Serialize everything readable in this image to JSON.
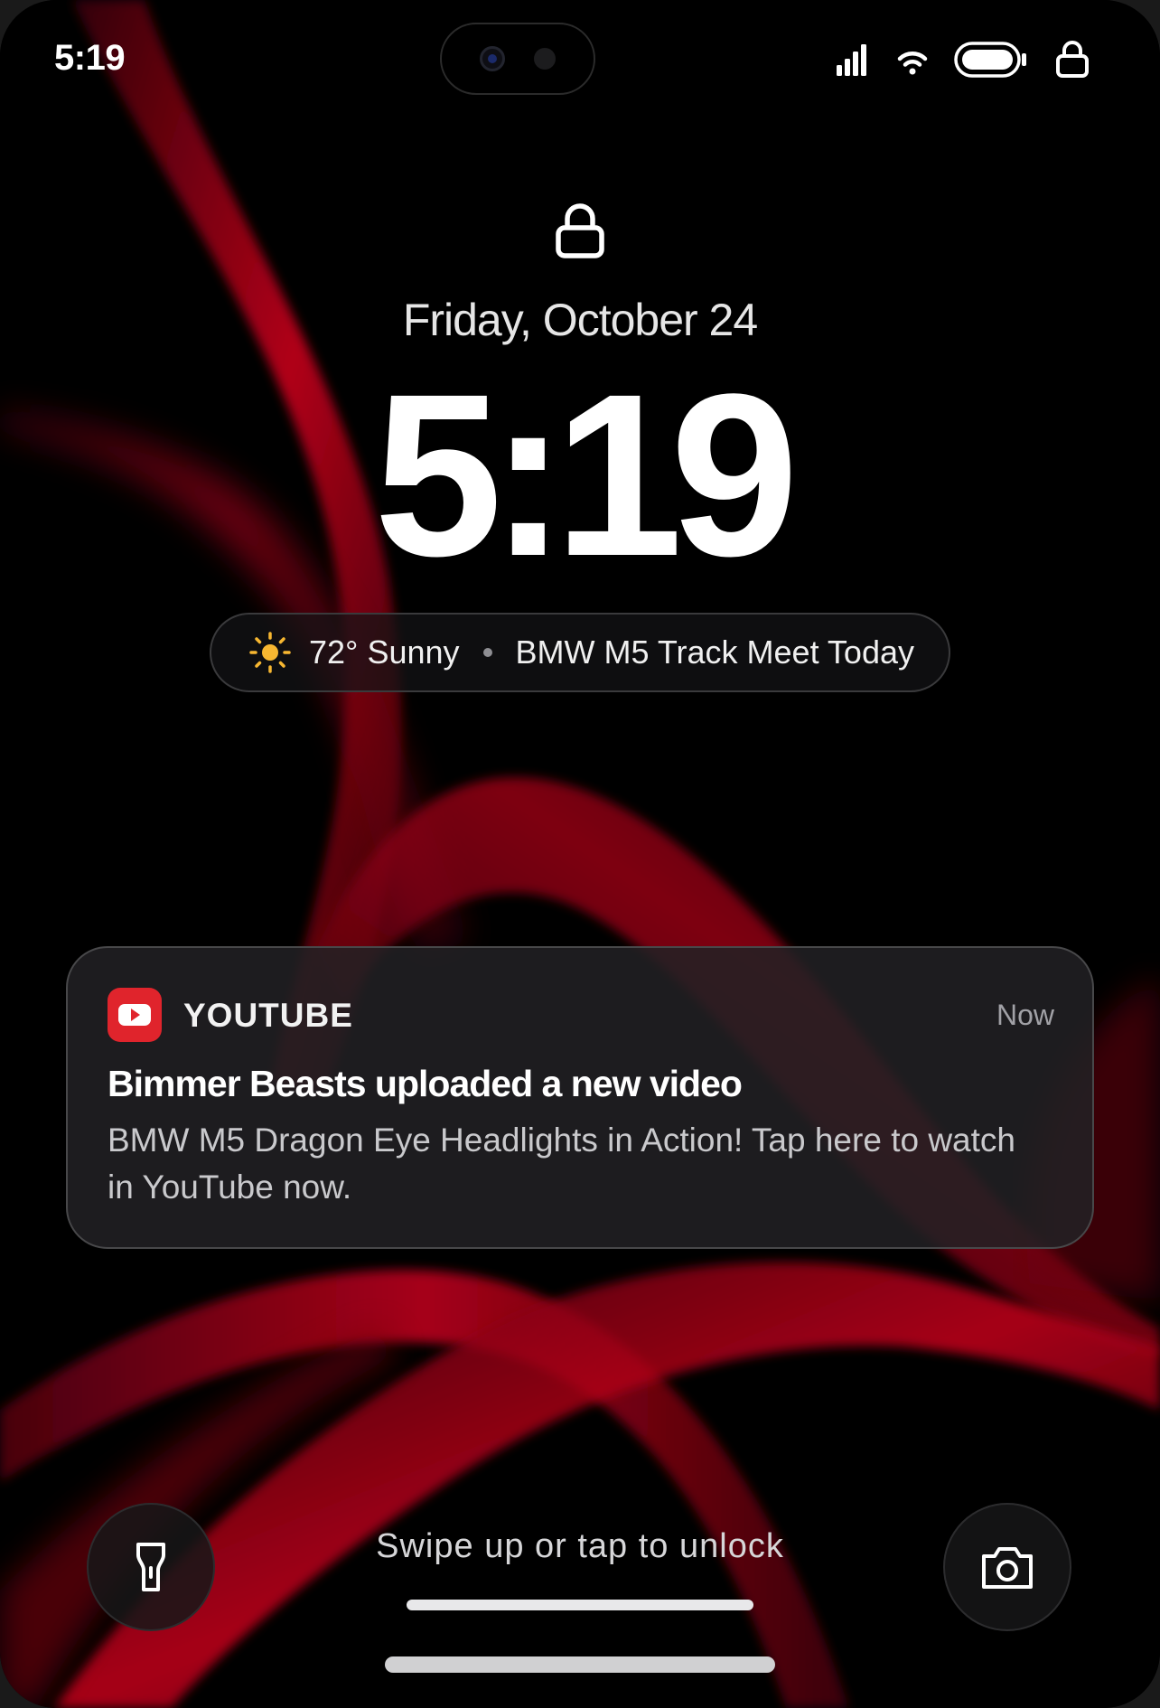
{
  "status_bar": {
    "time": "5:19",
    "icons": [
      "signal-icon",
      "wifi-icon",
      "battery-icon",
      "lock-icon"
    ]
  },
  "lock_screen": {
    "lock_icon": "lock-icon",
    "date": "Friday, October 24",
    "time": "5:19"
  },
  "widget": {
    "weather_icon": "sun-icon",
    "weather": "72° Sunny",
    "event": "BMW M5 Track Meet Today"
  },
  "notification": {
    "app_icon": "youtube-icon",
    "app_name": "YOUTUBE",
    "time": "Now",
    "title": "Bimmer Beasts uploaded a new video",
    "body": "BMW M5 Dragon Eye Headlights in Action! Tap here to watch in YouTube now."
  },
  "bottom": {
    "flashlight_icon": "flashlight-icon",
    "camera_icon": "camera-icon",
    "hint": "Swipe up or tap to unlock"
  },
  "colors": {
    "accent_red": "#c8001e",
    "youtube_red": "#e0242c",
    "sun_yellow": "#f7b731"
  }
}
